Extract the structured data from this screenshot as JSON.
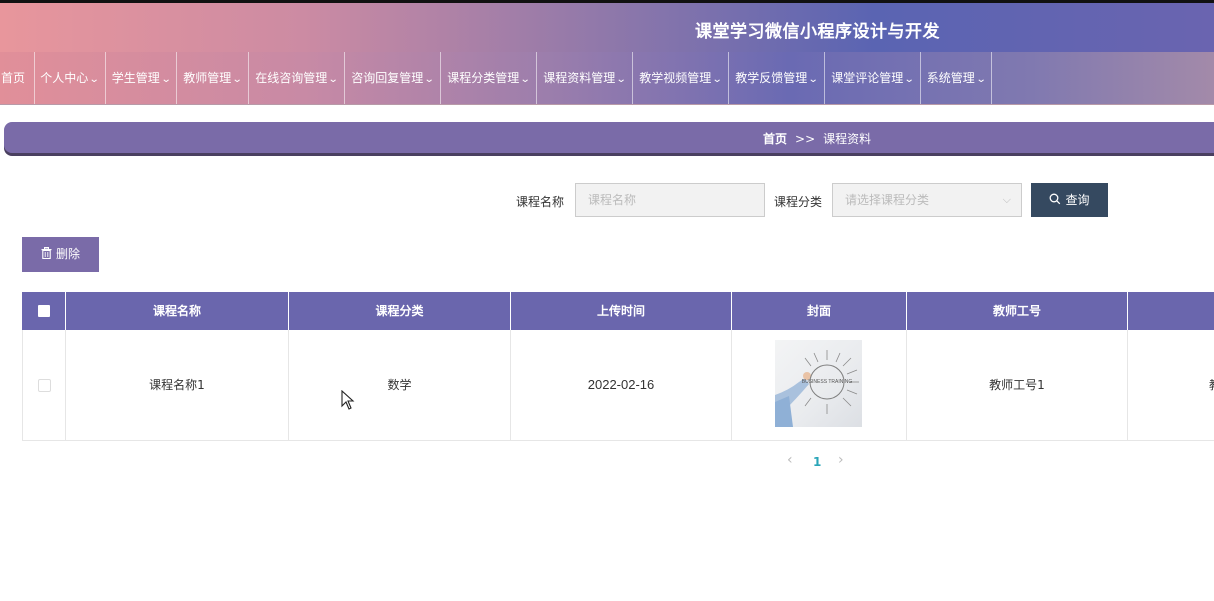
{
  "header": {
    "title": "课堂学习微信小程序设计与开发"
  },
  "nav": {
    "items": [
      {
        "label": "首页",
        "has_dropdown": false
      },
      {
        "label": "个人中心",
        "has_dropdown": true
      },
      {
        "label": "学生管理",
        "has_dropdown": true
      },
      {
        "label": "教师管理",
        "has_dropdown": true
      },
      {
        "label": "在线咨询管理",
        "has_dropdown": true
      },
      {
        "label": "咨询回复管理",
        "has_dropdown": true
      },
      {
        "label": "课程分类管理",
        "has_dropdown": true
      },
      {
        "label": "课程资料管理",
        "has_dropdown": true
      },
      {
        "label": "教学视频管理",
        "has_dropdown": true
      },
      {
        "label": "教学反馈管理",
        "has_dropdown": true
      },
      {
        "label": "课堂评论管理",
        "has_dropdown": true
      },
      {
        "label": "系统管理",
        "has_dropdown": true
      }
    ]
  },
  "breadcrumb": {
    "home": "首页",
    "separator": ">>",
    "current": "课程资料"
  },
  "search": {
    "name_label": "课程名称",
    "name_placeholder": "课程名称",
    "category_label": "课程分类",
    "category_placeholder": "请选择课程分类",
    "query_label": "查询"
  },
  "actions": {
    "delete_label": "删除"
  },
  "table": {
    "headers": [
      "课程名称",
      "课程分类",
      "上传时间",
      "封面",
      "教师工号"
    ],
    "rows": [
      {
        "course_name": "课程名称1",
        "category": "数学",
        "upload_time": "2022-02-16",
        "cover_text": "BUSINESS TRAINING",
        "teacher_id": "教师工号1",
        "overflow_text": "教"
      }
    ]
  },
  "pagination": {
    "prev": "‹",
    "current_page": "1",
    "next": "›"
  },
  "colors": {
    "accent": "#7a6ba8",
    "table_header": "#6a66ad",
    "query_button": "#354960",
    "page_active": "#2aa5b8"
  }
}
